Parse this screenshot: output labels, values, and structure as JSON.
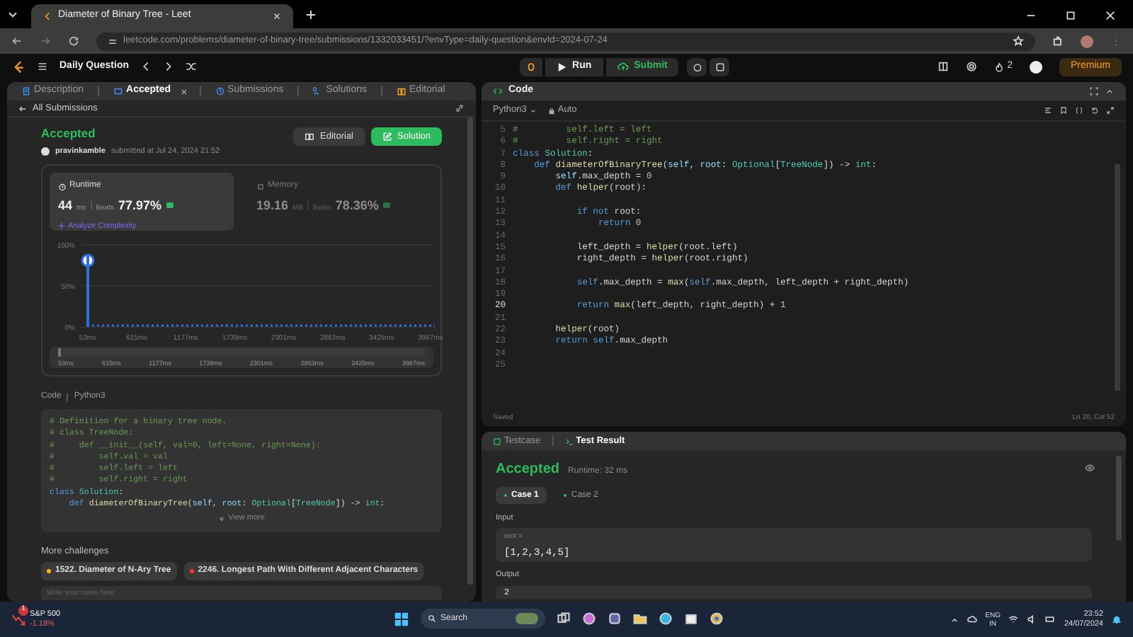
{
  "browser": {
    "tab_title": "Diameter of Binary Tree - Leet",
    "url": "leetcode.com/problems/diameter-of-binary-tree/submissions/1332033451/?envType=daily-question&envId=2024-07-24"
  },
  "toolbar": {
    "title": "Daily Question",
    "run": "Run",
    "submit": "Submit",
    "streak": "2",
    "premium": "Premium"
  },
  "left_tabs": [
    {
      "label": "Description",
      "selected": false
    },
    {
      "label": "Accepted",
      "selected": true
    },
    {
      "label": "Submissions",
      "selected": false
    },
    {
      "label": "Solutions",
      "selected": false
    },
    {
      "label": "Editorial",
      "selected": false
    }
  ],
  "back_link": "All Submissions",
  "submission": {
    "status": "Accepted",
    "user": "pravinkamble",
    "submitted": "submitted at Jul 24, 2024 21:52",
    "editorial": "Editorial",
    "solution": "Solution"
  },
  "stats": [
    {
      "title": "Runtime",
      "value": "44",
      "unit": "ms",
      "beats_label": "Beats",
      "beats": "77.97%",
      "selected": true,
      "link": "Analyze Complexity"
    },
    {
      "title": "Memory",
      "value": "19.16",
      "unit": "MB",
      "beats_label": "Beats",
      "beats": "78.36%",
      "selected": false
    }
  ],
  "chart_data": {
    "type": "bar",
    "categories": [
      "53ms",
      "615ms",
      "1177ms",
      "1739ms",
      "2301ms",
      "2863ms",
      "3425ms",
      "3987ms"
    ],
    "series": [
      {
        "color": "#2f6ee0",
        "values": [
          88,
          0,
          0,
          0,
          0,
          0,
          0,
          0
        ]
      }
    ],
    "ylim": [
      0,
      100
    ],
    "yticks": [
      {
        "value": 0,
        "label": "0%"
      },
      {
        "value": 50,
        "label": "50%"
      },
      {
        "value": 100,
        "label": "100%"
      }
    ]
  },
  "range": {
    "level": 1,
    "labels": [
      "53ms",
      "615ms",
      "1177ms",
      "1739ms",
      "2301ms",
      "2863ms",
      "3425ms",
      "3987ms"
    ]
  },
  "code_header": {
    "label": "Code",
    "language": "Python3"
  },
  "snippet": [
    [
      {
        "kind": "comment",
        "text": "# Definition for a binary tree node."
      }
    ],
    [
      {
        "kind": "comment",
        "text": "# class TreeNode:"
      }
    ],
    [
      {
        "kind": "comment",
        "text": "#     def __init__(self, val=0, left=None, right=None):"
      }
    ],
    [
      {
        "kind": "comment",
        "text": "#         self.val = val"
      }
    ],
    [
      {
        "kind": "comment",
        "text": "#         self.left = left"
      }
    ],
    [
      {
        "kind": "comment",
        "text": "#         self.right = right"
      }
    ],
    [
      {
        "kind": "keyword",
        "text": "class "
      },
      {
        "kind": "type",
        "text": "Solution"
      },
      {
        "kind": "plain",
        "text": ":"
      }
    ],
    [
      {
        "kind": "keyword",
        "text": "    def "
      },
      {
        "kind": "function",
        "text": "diameterOfBinaryTree"
      },
      {
        "kind": "plain",
        "text": "("
      },
      {
        "kind": "variable",
        "text": "self"
      },
      {
        "kind": "plain",
        "text": ", "
      },
      {
        "kind": "variable",
        "text": "root"
      },
      {
        "kind": "plain",
        "text": ": "
      },
      {
        "kind": "type",
        "text": "Optional"
      },
      {
        "kind": "plain",
        "text": "["
      },
      {
        "kind": "type",
        "text": "TreeNode"
      },
      {
        "kind": "plain",
        "text": "]) -> "
      },
      {
        "kind": "type",
        "text": "int"
      },
      {
        "kind": "plain",
        "text": ":"
      }
    ]
  ],
  "view_more": "View more",
  "more_title": "More challenges",
  "challenges": [
    {
      "label": "1522. Diameter of N-Ary Tree",
      "color": "#ffb800"
    },
    {
      "label": "2246. Longest Path With Different Adjacent Characters",
      "color": "#f63737"
    }
  ],
  "notes": {
    "placeholder": "Write your notes here"
  },
  "editor": {
    "title": "Code",
    "language": "Python3",
    "mode": "Auto",
    "saved": "Saved",
    "cursor": "Ln 20, Col 52",
    "lines": [
      {
        "n": "5",
        "current": false,
        "spans": [
          {
            "kind": "comment",
            "text": "#         self.left = left"
          }
        ]
      },
      {
        "n": "6",
        "current": false,
        "spans": [
          {
            "kind": "comment",
            "text": "#         self.right = right"
          }
        ]
      },
      {
        "n": "7",
        "current": false,
        "spans": [
          {
            "kind": "keyword",
            "text": "class "
          },
          {
            "kind": "type",
            "text": "Solution"
          },
          {
            "kind": "plain",
            "text": ":"
          }
        ]
      },
      {
        "n": "8",
        "current": false,
        "spans": [
          {
            "kind": "keyword",
            "text": "    def "
          },
          {
            "kind": "function",
            "text": "diameterOfBinaryTree"
          },
          {
            "kind": "plain",
            "text": "("
          },
          {
            "kind": "variable",
            "text": "self"
          },
          {
            "kind": "plain",
            "text": ", "
          },
          {
            "kind": "variable",
            "text": "root"
          },
          {
            "kind": "plain",
            "text": ": "
          },
          {
            "kind": "type",
            "text": "Optional"
          },
          {
            "kind": "plain",
            "text": "["
          },
          {
            "kind": "type",
            "text": "TreeNode"
          },
          {
            "kind": "plain",
            "text": "]) -> "
          },
          {
            "kind": "type",
            "text": "int"
          },
          {
            "kind": "plain",
            "text": ":"
          }
        ]
      },
      {
        "n": "9",
        "current": false,
        "spans": [
          {
            "kind": "variable",
            "text": "        self"
          },
          {
            "kind": "plain",
            "text": ".max_depth = "
          },
          {
            "kind": "number",
            "text": "0"
          }
        ]
      },
      {
        "n": "10",
        "current": false,
        "spans": [
          {
            "kind": "keyword",
            "text": "        def "
          },
          {
            "kind": "function",
            "text": "helper"
          },
          {
            "kind": "plain",
            "text": "(root):"
          }
        ]
      },
      {
        "n": "11",
        "current": false
      },
      {
        "n": "12",
        "current": false,
        "spans": [
          {
            "kind": "keyword",
            "text": "            if not "
          },
          {
            "kind": "plain",
            "text": "root:"
          }
        ]
      },
      {
        "n": "13",
        "current": false,
        "spans": [
          {
            "kind": "keyword",
            "text": "                return "
          },
          {
            "kind": "number",
            "text": "0"
          }
        ]
      },
      {
        "n": "14",
        "current": false
      },
      {
        "n": "15",
        "current": false,
        "spans": [
          {
            "kind": "plain",
            "text": "            left_depth = "
          },
          {
            "kind": "function",
            "text": "helper"
          },
          {
            "kind": "plain",
            "text": "(root.left)"
          }
        ]
      },
      {
        "n": "16",
        "current": false,
        "spans": [
          {
            "kind": "plain",
            "text": "            right_depth = "
          },
          {
            "kind": "function",
            "text": "helper"
          },
          {
            "kind": "plain",
            "text": "(root.right)"
          }
        ]
      },
      {
        "n": "17",
        "current": false
      },
      {
        "n": "18",
        "current": false,
        "spans": [
          {
            "kind": "keyword",
            "text": "            self"
          },
          {
            "kind": "plain",
            "text": ".max_depth = "
          },
          {
            "kind": "function",
            "text": "max"
          },
          {
            "kind": "plain",
            "text": "("
          },
          {
            "kind": "keyword",
            "text": "self"
          },
          {
            "kind": "plain",
            "text": ".max_depth, left_depth + right_depth)"
          }
        ]
      },
      {
        "n": "19",
        "current": false
      },
      {
        "n": "20",
        "current": true,
        "spans": [
          {
            "kind": "keyword",
            "text": "            return "
          },
          {
            "kind": "function",
            "text": "max"
          },
          {
            "kind": "plain",
            "text": "(left_depth, right_depth) + "
          },
          {
            "kind": "number",
            "text": "1"
          }
        ]
      },
      {
        "n": "21",
        "current": false
      },
      {
        "n": "22",
        "current": false,
        "spans": [
          {
            "kind": "function",
            "text": "        helper"
          },
          {
            "kind": "plain",
            "text": "(root)"
          }
        ]
      },
      {
        "n": "23",
        "current": false,
        "spans": [
          {
            "kind": "keyword",
            "text": "        return self"
          },
          {
            "kind": "plain",
            "text": ".max_depth"
          }
        ]
      },
      {
        "n": "24",
        "current": false
      },
      {
        "n": "25",
        "current": false
      }
    ]
  },
  "result_tabs": [
    {
      "label": "Testcase",
      "selected": false
    },
    {
      "label": "Test Result",
      "selected": true
    }
  ],
  "result": {
    "status": "Accepted",
    "runtime": "Runtime: 32 ms",
    "input_label": "Input",
    "var": "root =",
    "input": "[1,2,3,4,5]",
    "output_label": "Output",
    "output": "2"
  },
  "cases": [
    {
      "label": "Case 1",
      "selected": true
    },
    {
      "label": "Case 2",
      "selected": false
    }
  ],
  "taskbar": {
    "ticker": "S&P 500",
    "change": "-1.18%",
    "badge": "1",
    "search": "Search",
    "lang": "ENG",
    "region": "IN",
    "time": "23:52",
    "date": "24/07/2024"
  }
}
